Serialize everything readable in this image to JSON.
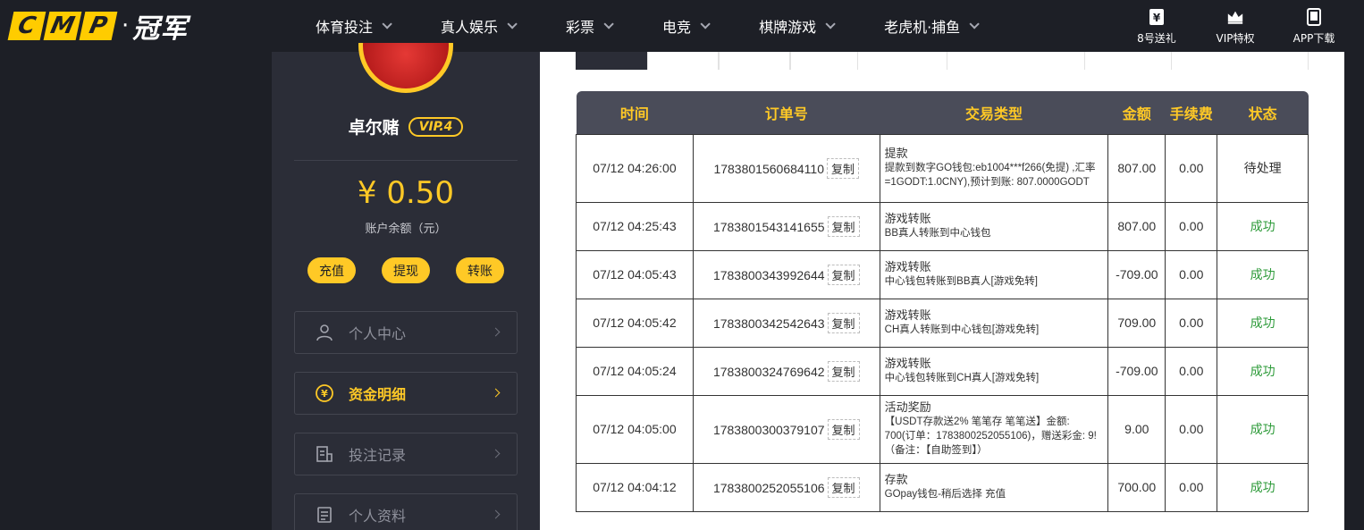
{
  "logo": {
    "letters": [
      "C",
      "M",
      "P"
    ],
    "dot": "·",
    "cn": "冠军"
  },
  "nav": [
    {
      "label": "体育投注"
    },
    {
      "label": "真人娱乐"
    },
    {
      "label": "彩票"
    },
    {
      "label": "电竞"
    },
    {
      "label": "棋牌游戏"
    },
    {
      "label": "老虎机·捕鱼"
    }
  ],
  "top_right": [
    {
      "label": "8号送礼",
      "icon": "gift-icon"
    },
    {
      "label": "VIP特权",
      "icon": "crown-icon"
    },
    {
      "label": "APP下载",
      "icon": "phone-icon"
    }
  ],
  "profile": {
    "username": "卓尔赌",
    "vip": "VIP.4",
    "balance": "¥ 0.50",
    "balance_label": "账户余额（元）"
  },
  "actions": [
    {
      "label": "充值"
    },
    {
      "label": "提现"
    },
    {
      "label": "转账"
    }
  ],
  "menu": [
    {
      "label": "个人中心",
      "icon": "user-icon",
      "active": false
    },
    {
      "label": "资金明细",
      "icon": "yuan-coin-icon",
      "active": true
    },
    {
      "label": "投注记录",
      "icon": "bet-record-icon",
      "active": false
    },
    {
      "label": "个人资料",
      "icon": "profile-doc-icon",
      "active": false
    }
  ],
  "table": {
    "headers": [
      "时间",
      "订单号",
      "交易类型",
      "金额",
      "手续费",
      "状态"
    ],
    "copy_label": "复制",
    "rows": [
      {
        "time": "07/12 04:26:00",
        "order": "1783801560684110",
        "type_title": "提款",
        "type_desc": "提款到数字GO钱包:eb1004***f266(免提) ,汇率=1GODT:1.0CNY),预计到账: 807.0000GODT",
        "amount": "807.00",
        "fee": "0.00",
        "status": "待处理"
      },
      {
        "time": "07/12 04:25:43",
        "order": "1783801543141655",
        "type_title": "游戏转账",
        "type_desc": "BB真人转账到中心钱包",
        "amount": "807.00",
        "fee": "0.00",
        "status": "成功"
      },
      {
        "time": "07/12 04:05:43",
        "order": "1783800343992644",
        "type_title": "游戏转账",
        "type_desc": "中心钱包转账到BB真人[游戏免转]",
        "amount": "-709.00",
        "fee": "0.00",
        "status": "成功"
      },
      {
        "time": "07/12 04:05:42",
        "order": "1783800342542643",
        "type_title": "游戏转账",
        "type_desc": "CH真人转账到中心钱包[游戏免转]",
        "amount": "709.00",
        "fee": "0.00",
        "status": "成功"
      },
      {
        "time": "07/12 04:05:24",
        "order": "1783800324769642",
        "type_title": "游戏转账",
        "type_desc": "中心钱包转账到CH真人[游戏免转]",
        "amount": "-709.00",
        "fee": "0.00",
        "status": "成功"
      },
      {
        "time": "07/12 04:05:00",
        "order": "1783800300379107",
        "type_title": "活动奖励",
        "type_desc": "【USDT存款送2% 笔笔存 笔笔送】金额: 700(订单：1783800252055106)，赠送彩金: 9! （备注：【自助签到】）",
        "amount": "9.00",
        "fee": "0.00",
        "status": "成功"
      },
      {
        "time": "07/12 04:04:12",
        "order": "1783800252055106",
        "type_title": "存款",
        "type_desc": "GOpay钱包-稍后选择 充值",
        "amount": "700.00",
        "fee": "0.00",
        "status": "成功"
      }
    ]
  },
  "colors": {
    "accent": "#ffc926",
    "success": "#2e9b3a",
    "header_bg": "#1d1f26",
    "panel_bg": "#2b2d37",
    "table_head": "#4a4c59"
  }
}
